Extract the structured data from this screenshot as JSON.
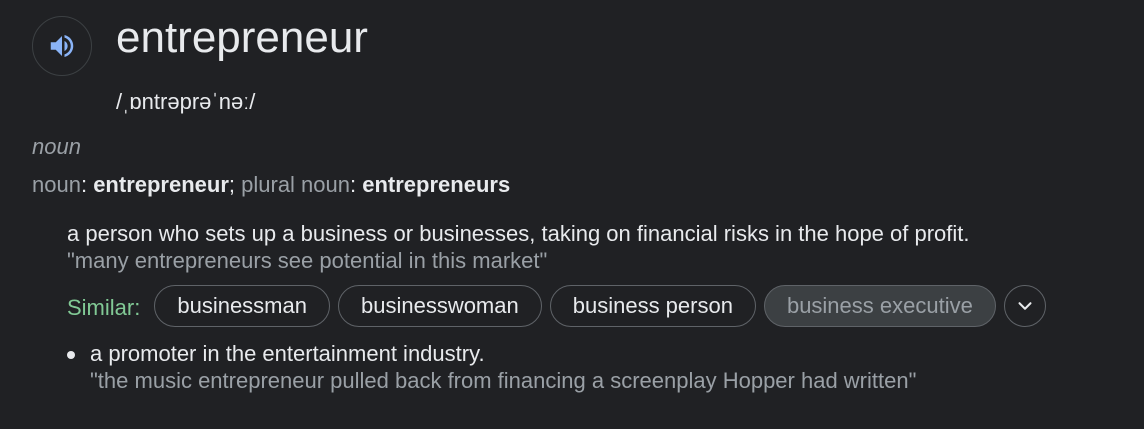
{
  "entry": {
    "word": "entrepreneur",
    "phonetic": "/ˌɒntrəprəˈnəː/",
    "part_of_speech": "noun",
    "speaker_icon": "volume-icon"
  },
  "forms": {
    "noun_label": "noun",
    "sep1": ": ",
    "singular": "entrepreneur",
    "semicolon": "; ",
    "plural_label": "plural noun",
    "sep2": ": ",
    "plural": "entrepreneurs"
  },
  "senses": [
    {
      "definition": "a person who sets up a business or businesses, taking on financial risks in the hope of profit.",
      "example": "\"many entrepreneurs see potential in this market\""
    },
    {
      "definition": "a promoter in the entertainment industry.",
      "example": "\"the music entrepreneur pulled back from financing a screenplay Hopper had written\""
    }
  ],
  "similar": {
    "label": "Similar:",
    "chips": [
      "businessman",
      "businesswoman",
      "business person",
      "business executive"
    ],
    "expand_icon": "chevron-down-icon"
  },
  "colors": {
    "background": "#202124",
    "text": "#e8eaed",
    "muted": "#9aa0a6",
    "similar_label": "#81c995",
    "speaker_icon": "#8ab4f8"
  }
}
